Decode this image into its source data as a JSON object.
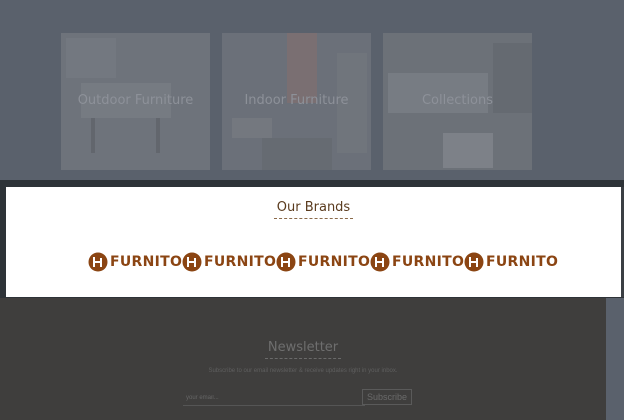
{
  "categories": [
    {
      "label": "Outdoor Furniture"
    },
    {
      "label": "Indoor Furniture"
    },
    {
      "label": "Collections"
    }
  ],
  "brands": {
    "title": "Our Brands",
    "items": [
      {
        "name": "FURNITO",
        "icon": "chair-logo-icon"
      },
      {
        "name": "FURNITO",
        "icon": "chair-logo-icon"
      },
      {
        "name": "FURNITO",
        "icon": "chair-logo-icon"
      },
      {
        "name": "FURNITO",
        "icon": "chair-logo-icon"
      },
      {
        "name": "FURNITO",
        "icon": "chair-logo-icon"
      }
    ],
    "brand_color": "#8b4513"
  },
  "newsletter": {
    "title": "Newsletter",
    "subtitle": "Subscribe to our email newsletter & receive updates right in your inbox.",
    "email_placeholder": "your email...",
    "subscribe_label": "Subscribe"
  }
}
